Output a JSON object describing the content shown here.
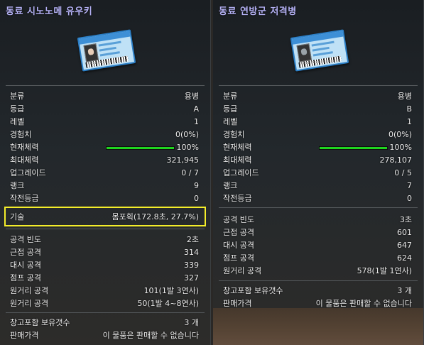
{
  "left": {
    "title": "동료 시노노메 유우키",
    "info": [
      {
        "label": "분류",
        "value": "용병"
      },
      {
        "label": "등급",
        "value": "A"
      },
      {
        "label": "레벨",
        "value": "1"
      },
      {
        "label": "경험치",
        "value": "0(0%)"
      },
      {
        "label": "현재체력",
        "value": "100%"
      },
      {
        "label": "최대체력",
        "value": "321,945"
      },
      {
        "label": "업그레이드",
        "value": "0 / 7"
      },
      {
        "label": "랭크",
        "value": "9"
      },
      {
        "label": "작전등급",
        "value": "0"
      }
    ],
    "hp_fraction": 1.0,
    "skill": {
      "label": "기술",
      "value": "몸포획(172.8초, 27.7%)"
    },
    "attack": [
      {
        "label": "공격 빈도",
        "value": "2초"
      },
      {
        "label": "근접 공격",
        "value": "314"
      },
      {
        "label": "대시 공격",
        "value": "339"
      },
      {
        "label": "점프 공격",
        "value": "327"
      },
      {
        "label": "원거리 공격",
        "value": "101(1발 3연사)"
      },
      {
        "label": "원거리 공격",
        "value": "50(1발 4~8연사)"
      }
    ],
    "extra": [
      {
        "label": "창고포함 보유갯수",
        "value": "3 개"
      },
      {
        "label": "판매가격",
        "value": "이 물품은 판매할 수 없습니다"
      }
    ]
  },
  "right": {
    "title": "동료 연방군 저격병",
    "info": [
      {
        "label": "분류",
        "value": "용병"
      },
      {
        "label": "등급",
        "value": "B"
      },
      {
        "label": "레벨",
        "value": "1"
      },
      {
        "label": "경험치",
        "value": "0(0%)"
      },
      {
        "label": "현재체력",
        "value": "100%"
      },
      {
        "label": "최대체력",
        "value": "278,107"
      },
      {
        "label": "업그레이드",
        "value": "0 / 5"
      },
      {
        "label": "랭크",
        "value": "7"
      },
      {
        "label": "작전등급",
        "value": "0"
      }
    ],
    "hp_fraction": 1.0,
    "attack": [
      {
        "label": "공격 빈도",
        "value": "3초"
      },
      {
        "label": "근접 공격",
        "value": "601"
      },
      {
        "label": "대시 공격",
        "value": "647"
      },
      {
        "label": "점프 공격",
        "value": "624"
      },
      {
        "label": "원거리 공격",
        "value": "578(1발 1연사)"
      }
    ],
    "extra": [
      {
        "label": "창고포함 보유갯수",
        "value": "3 개"
      },
      {
        "label": "판매가격",
        "value": "이 물품은 판매할 수 없습니다"
      }
    ]
  },
  "colors": {
    "title": "#b6b3f7",
    "hp_bar": "#1fd41f",
    "highlight_border": "#f4ed2a"
  }
}
